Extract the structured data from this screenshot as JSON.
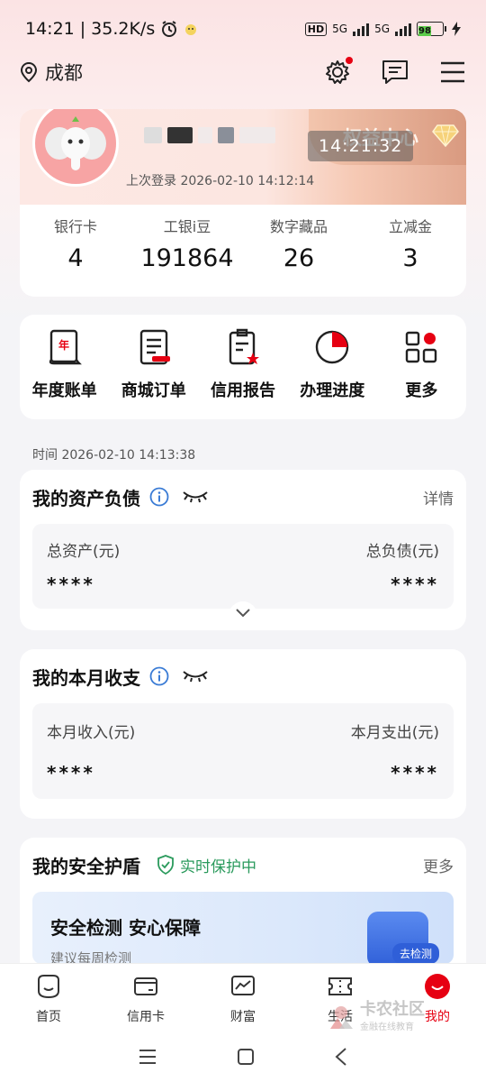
{
  "status_bar": {
    "time": "14:21",
    "speed": "35.2K/s",
    "hd": "HD",
    "net1": "5G",
    "net2": "5G",
    "battery": "98"
  },
  "top_nav": {
    "city": "成都"
  },
  "profile": {
    "rights_center": "权益中心",
    "time_overlay": "14:21:32",
    "last_login": "上次登录 2026-02-10 14:12:14",
    "stats": [
      {
        "label": "银行卡",
        "value": "4"
      },
      {
        "label": "工银i豆",
        "value": "191864"
      },
      {
        "label": "数字藏品",
        "value": "26"
      },
      {
        "label": "立减金",
        "value": "3"
      }
    ]
  },
  "quick_actions": [
    {
      "label": "年度账单",
      "icon": "annual-bill-icon"
    },
    {
      "label": "商城订单",
      "icon": "mall-order-icon"
    },
    {
      "label": "信用报告",
      "icon": "credit-report-icon"
    },
    {
      "label": "办理进度",
      "icon": "progress-icon"
    },
    {
      "label": "更多",
      "icon": "more-grid-icon"
    }
  ],
  "timestamp": "时间 2026-02-10 14:13:38",
  "assets": {
    "title": "我的资产负债",
    "detail": "详情",
    "left_label": "总资产(元)",
    "right_label": "总负债(元)",
    "left_value": "****",
    "right_value": "****"
  },
  "monthly": {
    "title": "我的本月收支",
    "left_label": "本月收入(元)",
    "right_label": "本月支出(元)",
    "left_value": "****",
    "right_value": "****"
  },
  "security": {
    "title": "我的安全护盾",
    "status": "实时保护中",
    "more": "更多",
    "banner_title": "安全检测 安心保障",
    "banner_sub": "建议每周检测",
    "scan_label": "去检测"
  },
  "bottom_tabs": [
    {
      "label": "首页",
      "icon": "home-icon"
    },
    {
      "label": "信用卡",
      "icon": "credit-card-icon"
    },
    {
      "label": "财富",
      "icon": "wealth-icon"
    },
    {
      "label": "生活",
      "icon": "life-ticket-icon"
    },
    {
      "label": "我的",
      "icon": "mine-icon"
    }
  ],
  "watermark": {
    "title": "卡农社区",
    "sub": "金融在线教育"
  },
  "colors": {
    "brand_red": "#e60012",
    "safe_green": "#2a9a5c",
    "info_blue": "#3a7bd5"
  }
}
